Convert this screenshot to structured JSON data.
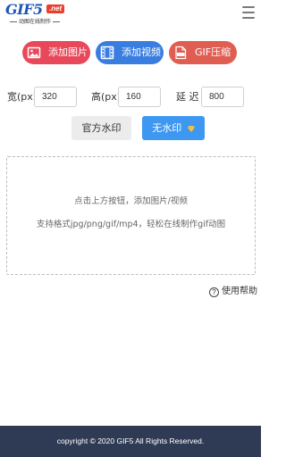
{
  "header": {
    "logo_main": "GIF5",
    "logo_net": ".net",
    "logo_sub": "动图在线制作",
    "menu_icon": "hamburger-menu-icon"
  },
  "upload_buttons": {
    "add_image": {
      "label": "添加图片",
      "icon": "image-icon",
      "color": "#e8495a"
    },
    "add_video": {
      "label": "添加视频",
      "icon": "film-icon",
      "color": "#3a7de0"
    },
    "gif_compress": {
      "label": "GIF压缩",
      "icon": "gif-file-icon",
      "color": "#e05d52"
    }
  },
  "params": {
    "width_label": "宽(px)",
    "width_value": "320",
    "height_label": "高(px)",
    "height_value": "160",
    "delay_label": "延 迟",
    "delay_value": "800"
  },
  "watermark": {
    "official_label": "官方水印",
    "none_label": "无水印",
    "none_icon": "diamond-icon",
    "accent": "#3e97f0"
  },
  "dropzone": {
    "line1": "点击上方按钮，添加图片/视频",
    "line2": "支持格式jpg/png/gif/mp4，轻松在线制作gif动图"
  },
  "help": {
    "label": "使用帮助",
    "icon": "question-circle-icon"
  },
  "footer": {
    "text": "copyright © 2020 GIF5 All Rights Reserved.",
    "color": "#2f3b55"
  }
}
